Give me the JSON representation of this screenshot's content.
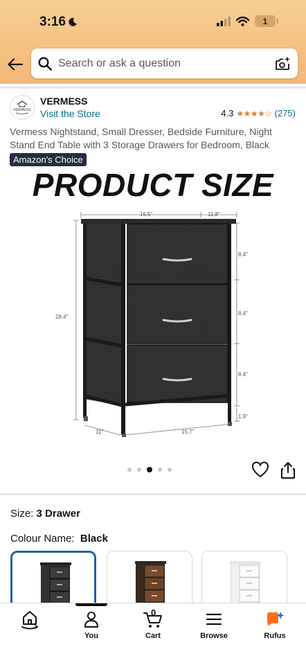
{
  "status_bar": {
    "time": "3:16",
    "battery": "1"
  },
  "search": {
    "placeholder": "Search or ask a question"
  },
  "store": {
    "logo_text": "VERMESS",
    "name": "VERMESS",
    "link": "Visit the Store",
    "rating": "4.3",
    "stars": "★★★★☆",
    "review_count": "(275)"
  },
  "product": {
    "title": "Vermess Nightstand, Small Dresser, Bedside Furniture, Night Stand End Table with 3 Storage Drawers for Bedroom, Black",
    "badge": "Amazon's Choice",
    "image_heading": "PRODUCT SIZE",
    "dimensions": {
      "top_width": "16.5\"",
      "top_depth": "11.8\"",
      "height": "28.4\"",
      "drawer_1": "8.4\"",
      "drawer_2": "8.4\"",
      "drawer_3": "8.4\"",
      "foot": "1.9\"",
      "base_depth": "11\"",
      "base_width": "15.7\""
    },
    "carousel": {
      "count": 5,
      "active_index": 2
    }
  },
  "options": {
    "size_label": "Size:",
    "size_value": "3 Drawer",
    "colour_label": "Colour Name:",
    "colour_value": "Black",
    "swatches": [
      {
        "name": "Black",
        "selected": true
      },
      {
        "name": "Rustic Brown",
        "selected": false
      },
      {
        "name": "White",
        "selected": false
      }
    ]
  },
  "bottom_nav": {
    "items": [
      {
        "label": "",
        "icon": "home-icon"
      },
      {
        "label": "You",
        "icon": "person-icon"
      },
      {
        "label": "Cart",
        "icon": "cart-icon",
        "badge": "0"
      },
      {
        "label": "Browse",
        "icon": "menu-icon"
      },
      {
        "label": "Rufus",
        "icon": "rufus-icon"
      }
    ]
  },
  "colors": {
    "header_gradient_top": "#f7cf94",
    "link": "#007185",
    "star": "#de7921",
    "badge_bg": "#232f3e",
    "selected_border": "#2162a1",
    "rufus_orange": "#ff6f1e",
    "rufus_blue": "#1b6fe0"
  }
}
